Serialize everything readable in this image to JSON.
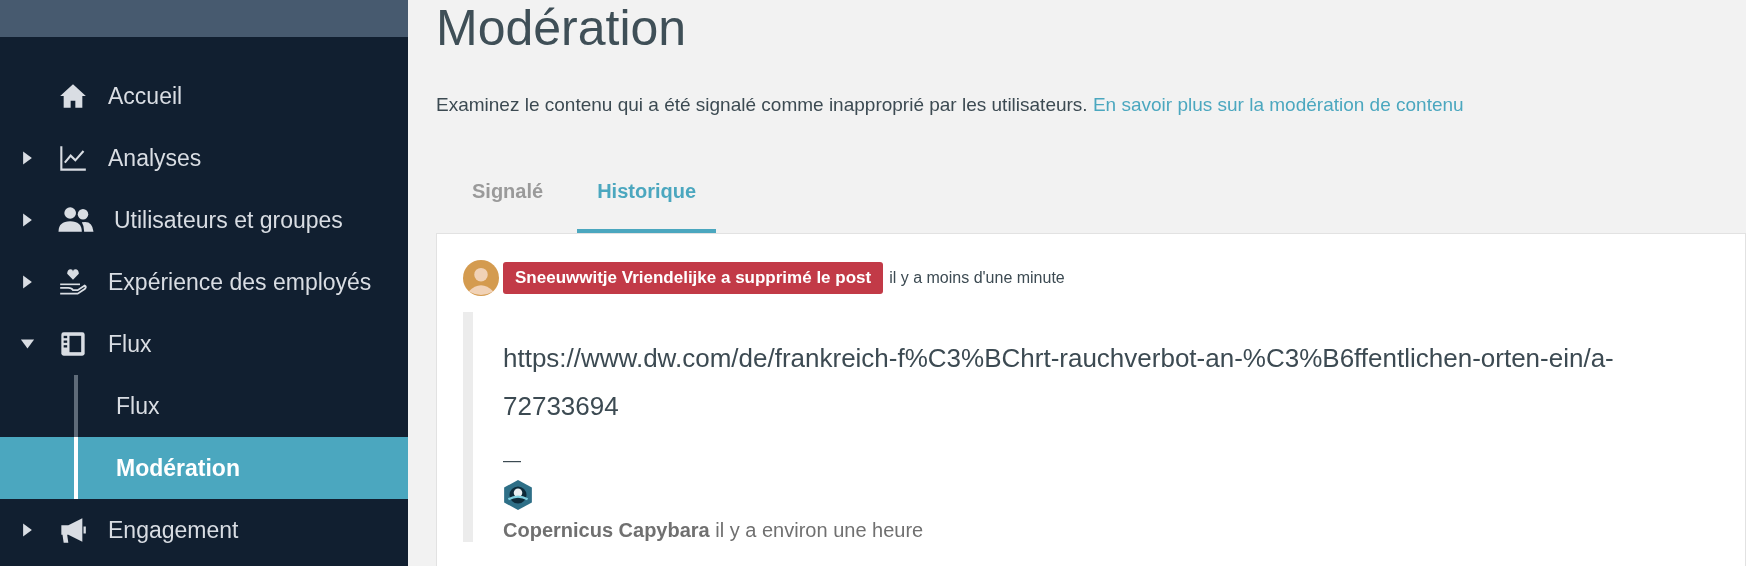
{
  "sidebar": {
    "items": [
      {
        "label": "Accueil",
        "kind": "link",
        "selected": false
      },
      {
        "label": "Analyses",
        "kind": "group",
        "expanded": false,
        "selected": false
      },
      {
        "label": "Utilisateurs et groupes",
        "kind": "group",
        "expanded": false,
        "selected": false
      },
      {
        "label": "Expérience des employés",
        "kind": "group",
        "expanded": false,
        "selected": false
      },
      {
        "label": "Flux",
        "kind": "group",
        "expanded": true,
        "selected": false,
        "children": [
          {
            "label": "Flux",
            "selected": false
          },
          {
            "label": "Modération",
            "selected": true
          }
        ]
      },
      {
        "label": "Engagement",
        "kind": "group",
        "expanded": false,
        "selected": false
      }
    ]
  },
  "page": {
    "title": "Modération",
    "description": "Examinez le contenu qui a été signalé comme inapproprié par les utilisateurs.",
    "help_link": "En savoir plus sur la modération de contenu"
  },
  "tabs": [
    {
      "label": "Signalé",
      "selected": false
    },
    {
      "label": "Historique",
      "selected": true
    }
  ],
  "history": [
    {
      "action": "Sneeuwwitje Vriendelijke a supprimé le post",
      "time": "il y a moins d'une minute",
      "post": {
        "text": "https://www.dw.com/de/frankreich-f%C3%BChrt-rauchverbot-an-%C3%B6ffentlichen-orten-ein/a-72733694",
        "separator": "—",
        "author": "Copernicus Capybara",
        "time": "il y a environ une heure"
      }
    }
  ]
}
